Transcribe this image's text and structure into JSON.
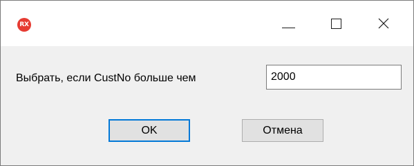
{
  "window": {
    "app_icon_text": "RX",
    "controls": {
      "minimize_icon": "minimize-icon",
      "maximize_icon": "maximize-icon",
      "close_icon": "close-icon"
    }
  },
  "dialog": {
    "prompt": "Выбрать, если CustNo больше чем",
    "input_value": "2000",
    "ok_label": "OK",
    "cancel_label": "Отмена"
  },
  "colors": {
    "app_icon": "#e63b32",
    "default_button_border": "#0078d7",
    "client_background": "#f0f0f0"
  }
}
